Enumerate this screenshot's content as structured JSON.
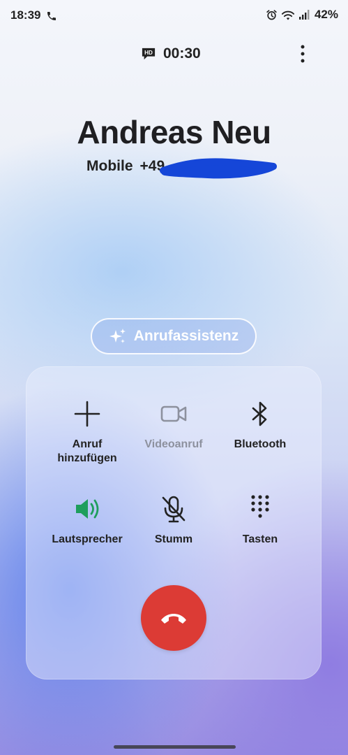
{
  "status_bar": {
    "time": "18:39",
    "battery": "42%",
    "icons": [
      "phone-call-icon",
      "alarm-icon",
      "wifi-icon",
      "signal-icon"
    ]
  },
  "call": {
    "timer": "00:30",
    "hd_badge": "HD",
    "contact_name": "Andreas Neu",
    "number_type": "Mobile",
    "number_visible": "+49"
  },
  "assistant": {
    "label": "Anrufassistenz"
  },
  "controls": [
    {
      "label": "Anruf\nhinzufügen",
      "icon": "plus-icon",
      "enabled": true
    },
    {
      "label": "Videoanruf",
      "icon": "video-camera-icon",
      "enabled": false
    },
    {
      "label": "Bluetooth",
      "icon": "bluetooth-icon",
      "enabled": true
    },
    {
      "label": "Lautsprecher",
      "icon": "speaker-icon",
      "enabled": true,
      "active": true
    },
    {
      "label": "Stumm",
      "icon": "mic-off-icon",
      "enabled": true
    },
    {
      "label": "Tasten",
      "icon": "keypad-icon",
      "enabled": true
    }
  ],
  "colors": {
    "end_call": "#dc3b35",
    "speaker_active": "#1e9e5c",
    "disabled": "#8d919e"
  }
}
